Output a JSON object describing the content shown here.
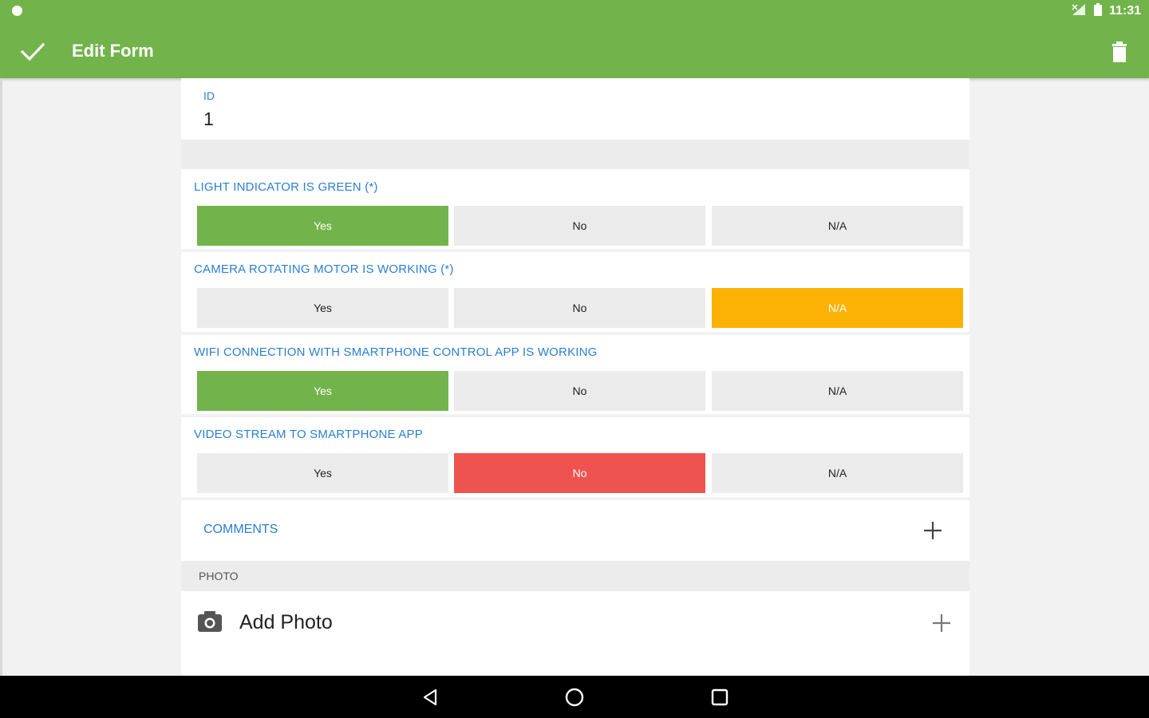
{
  "status_bar": {
    "time": "11:31"
  },
  "app_bar": {
    "title": "Edit Form"
  },
  "form": {
    "id_label": "ID",
    "id_value": "1",
    "questions": [
      {
        "label": "LIGHT INDICATOR IS GREEN (*)",
        "options": [
          "Yes",
          "No",
          "N/A"
        ],
        "selected": "Yes"
      },
      {
        "label": "CAMERA ROTATING MOTOR IS WORKING (*)",
        "options": [
          "Yes",
          "No",
          "N/A"
        ],
        "selected": "N/A"
      },
      {
        "label": "WIFI CONNECTION WITH SMARTPHONE CONTROL APP IS WORKING",
        "options": [
          "Yes",
          "No",
          "N/A"
        ],
        "selected": "Yes"
      },
      {
        "label": "VIDEO STREAM TO SMARTPHONE APP",
        "options": [
          "Yes",
          "No",
          "N/A"
        ],
        "selected": "No"
      }
    ],
    "comments_label": "COMMENTS",
    "photo_section_label": "PHOTO",
    "add_photo_label": "Add Photo"
  },
  "colors": {
    "app_bar": "#72b44b",
    "selected_yes": "#72b44b",
    "selected_na": "#fcb204",
    "selected_no": "#ef5350",
    "label_blue": "#2a7fd0"
  },
  "icons": {
    "save": "check-icon",
    "delete": "trash-icon",
    "add": "plus-icon",
    "photo": "camera-icon",
    "nav": [
      "back-icon",
      "home-icon",
      "recents-icon"
    ]
  }
}
